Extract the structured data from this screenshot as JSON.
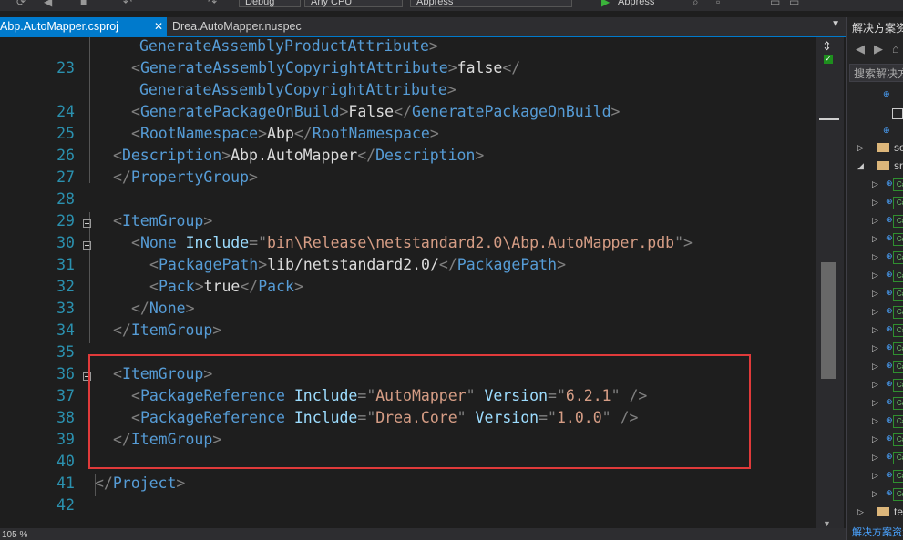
{
  "toolbar": {
    "config": "Debug",
    "platform": "Any CPU",
    "startup_project": "Abpress",
    "run_target": "Abpress"
  },
  "tabs": [
    {
      "label": "Abp.AutoMapper.csproj",
      "active": true
    },
    {
      "label": "Drea.AutoMapper.nuspec",
      "active": false
    }
  ],
  "editor": {
    "zoom": "105 %",
    "lines": [
      {
        "num": "",
        "text": "GenerateAssemblyProductAttribute>"
      },
      {
        "num": "23",
        "text": "<GenerateAssemblyCopyrightAttribute>false</"
      },
      {
        "num": "",
        "text": "GenerateAssemblyCopyrightAttribute>"
      },
      {
        "num": "24",
        "text": "<GeneratePackageOnBuild>False</GeneratePackageOnBuild>"
      },
      {
        "num": "25",
        "text": "<RootNamespace>Abp</RootNamespace>"
      },
      {
        "num": "26",
        "text": "<Description>Abp.AutoMapper</Description>"
      },
      {
        "num": "27",
        "text": "</PropertyGroup>"
      },
      {
        "num": "28",
        "text": ""
      },
      {
        "num": "29",
        "text": "<ItemGroup>"
      },
      {
        "num": "30",
        "text": "<None Include=\"bin\\Release\\netstandard2.0\\Abp.AutoMapper.pdb\">"
      },
      {
        "num": "31",
        "text": "<PackagePath>lib/netstandard2.0/</PackagePath>"
      },
      {
        "num": "32",
        "text": "<Pack>true</Pack>"
      },
      {
        "num": "33",
        "text": "</None>"
      },
      {
        "num": "34",
        "text": "</ItemGroup>"
      },
      {
        "num": "35",
        "text": ""
      },
      {
        "num": "36",
        "text": "<ItemGroup>"
      },
      {
        "num": "37",
        "text": "<PackageReference Include=\"AutoMapper\" Version=\"6.2.1\" />"
      },
      {
        "num": "38",
        "text": "<PackageReference Include=\"Drea.Core\" Version=\"1.0.0\" />"
      },
      {
        "num": "39",
        "text": "</ItemGroup>"
      },
      {
        "num": "40",
        "text": ""
      },
      {
        "num": "41",
        "text": "</Project>"
      },
      {
        "num": "42",
        "text": ""
      }
    ]
  },
  "solution_explorer": {
    "title": "解决方案资源管理器",
    "search_placeholder": "搜索解决方案资源管理器",
    "folders": [
      "sol",
      "src",
      "test"
    ],
    "bottom_tab": "解决方案资源管理器"
  },
  "colors": {
    "accent": "#007acc",
    "highlight_box": "#e03a3a",
    "tag": "#569cd6",
    "attribute": "#9cdcfe",
    "attr_value": "#d69d85"
  }
}
